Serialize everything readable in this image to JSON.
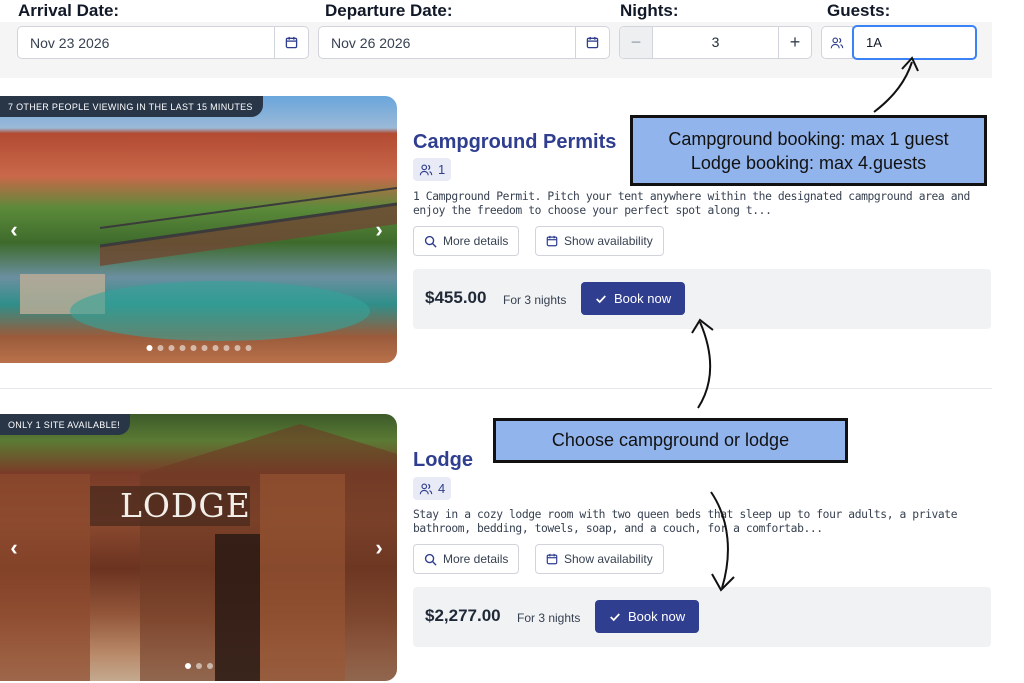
{
  "search": {
    "arrival_label": "Arrival Date:",
    "arrival_value": "Nov 23 2026",
    "departure_label": "Departure Date:",
    "departure_value": "Nov 26 2026",
    "nights_label": "Nights:",
    "nights_value": "3",
    "guests_label": "Guests:",
    "guests_value": "1A"
  },
  "listings": [
    {
      "badge": "7 OTHER PEOPLE VIEWING IN THE LAST 15 MINUTES",
      "title": "Campground Permits",
      "capacity": "1",
      "description": "1 Campground Permit. Pitch your tent anywhere within the designated campground area and enjoy the freedom to choose your perfect spot along t...",
      "more_details": "More details",
      "show_availability": "Show availability",
      "price": "$455.00",
      "nights_note": "For 3 nights",
      "book_label": "Book now"
    },
    {
      "badge": "ONLY 1 SITE AVAILABLE!",
      "title": "Lodge",
      "capacity": "4",
      "description": "Stay in a cozy lodge room with two queen beds that sleep up to four adults, a private bathroom, bedding, towels, soap, and a couch, for a comfortab...",
      "more_details": "More details",
      "show_availability": "Show availability",
      "price": "$2,277.00",
      "nights_note": "For 3 nights",
      "book_label": "Book now"
    }
  ],
  "annotations": {
    "guest_limits_line1": "Campground booking: max 1 guest",
    "guest_limits_line2": "Lodge booking: max 4.guests",
    "choose_text": "Choose campground or lodge"
  },
  "image_text": {
    "lodge_sign": "LODGE"
  },
  "colors": {
    "brand_navy": "#2f3e8f",
    "annotation_blue": "#92b4ec",
    "focus_blue": "#3b82f6"
  }
}
